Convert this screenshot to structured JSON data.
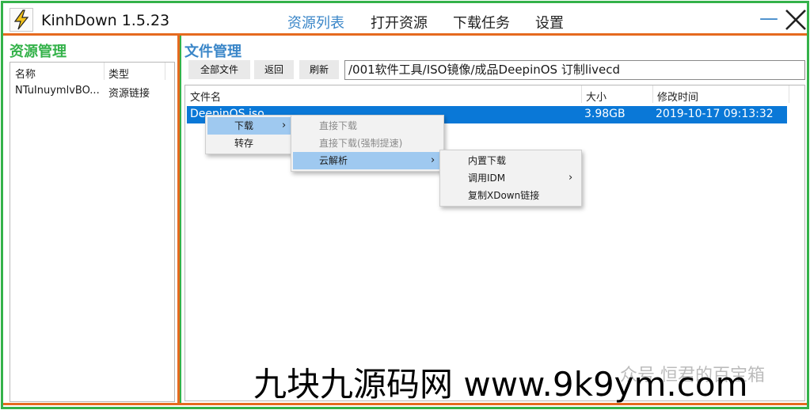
{
  "app": {
    "title": "KinhDown 1.5.23"
  },
  "nav": [
    {
      "label": "资源列表",
      "active": true
    },
    {
      "label": "打开资源",
      "active": false
    },
    {
      "label": "下载任务",
      "active": false
    },
    {
      "label": "设置",
      "active": false
    }
  ],
  "window": {
    "minimize": "—"
  },
  "colors": {
    "accent_green": "#34b24a",
    "accent_blue": "#3a86c8",
    "frame_orange": "#e56a1f",
    "selection": "#0a78d7"
  },
  "resource_panel": {
    "heading": "资源管理",
    "columns": [
      "名称",
      "类型"
    ],
    "rows": [
      {
        "name": "NTuInuymlvBO...",
        "type": "资源链接"
      }
    ]
  },
  "file_panel": {
    "heading": "文件管理",
    "toolbar": {
      "all_files": "全部文件",
      "back": "返回",
      "refresh": "刷新"
    },
    "path": "/001软件工具/ISO镜像/成品DeepinOS 订制livecd",
    "columns": {
      "name": "文件名",
      "size": "大小",
      "modified": "修改时间"
    },
    "rows": [
      {
        "name": "DeepinOS.iso",
        "size": "3.98GB",
        "modified": "2019-10-17 09:13:32"
      }
    ]
  },
  "context_menu": {
    "level1": [
      {
        "label": "下载",
        "arrow": "›"
      },
      {
        "label": "转存"
      }
    ],
    "level2": [
      {
        "label": "直接下载"
      },
      {
        "label": "直接下载(强制提速)"
      },
      {
        "label": "云解析",
        "arrow": "›"
      }
    ],
    "level3": [
      {
        "label": "内置下载"
      },
      {
        "label": "调用IDM",
        "arrow": "›"
      },
      {
        "label": "复制XDown链接"
      }
    ]
  },
  "watermark": {
    "text": "九块九源码网 www.9k9ym.com",
    "small": "众号 恒君的百宝箱"
  }
}
